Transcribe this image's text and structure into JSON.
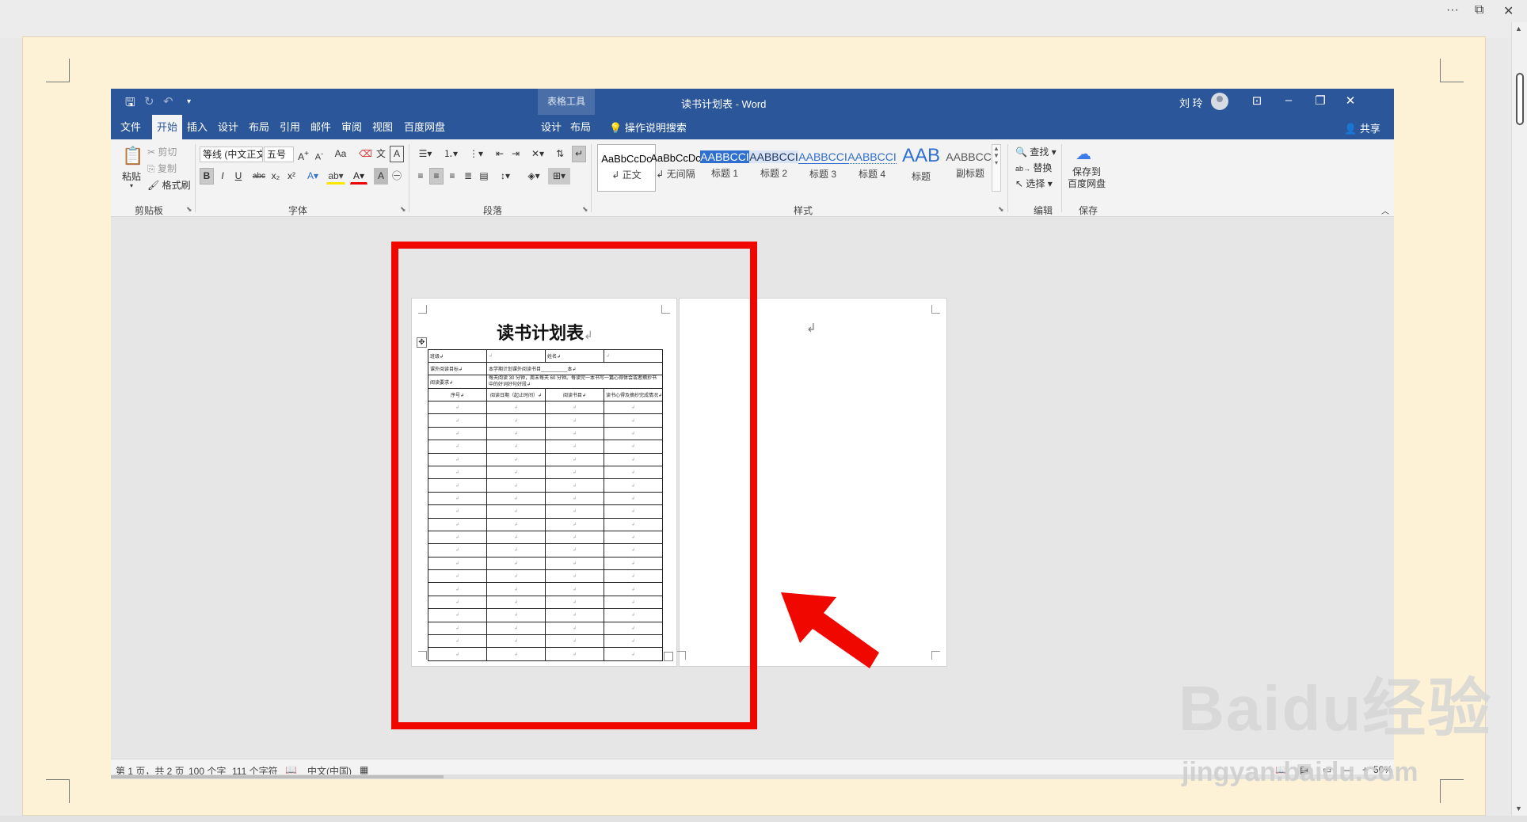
{
  "host": {
    "title_icons": [
      "more-icon",
      "restore-icon",
      "close-icon"
    ]
  },
  "word": {
    "qat": {
      "save_icon": "save-icon",
      "redo_icon": "redo-icon",
      "undo_icon": "undo-icon",
      "customize_icon": "customize-qat-icon"
    },
    "table_tools_label": "表格工具",
    "window_title": "读书计划表 - Word",
    "user_name": "刘 玲",
    "tabs": [
      {
        "label": "文件"
      },
      {
        "label": "开始"
      },
      {
        "label": "插入"
      },
      {
        "label": "设计"
      },
      {
        "label": "布局"
      },
      {
        "label": "引用"
      },
      {
        "label": "邮件"
      },
      {
        "label": "审阅"
      },
      {
        "label": "视图"
      },
      {
        "label": "百度网盘"
      },
      {
        "label": "设计"
      },
      {
        "label": "布局"
      }
    ],
    "tell_me": "操作说明搜索",
    "share": "共享",
    "ribbon": {
      "clipboard": {
        "paste": "粘贴",
        "cut": "剪切",
        "copy": "复制",
        "format_painter": "格式刷",
        "label": "剪贴板"
      },
      "font": {
        "font_name": "等线 (中文正文",
        "font_size": "五号",
        "label": "字体",
        "case": "Aa",
        "bold": "B",
        "italic": "I",
        "underline": "U",
        "strike": "abc",
        "sub": "x₂",
        "sup": "x²"
      },
      "paragraph": {
        "label": "段落"
      },
      "styles": {
        "label": "样式",
        "items": [
          {
            "preview": "AaBbCcDc",
            "name": "↲ 正文"
          },
          {
            "preview": "AaBbCcDc",
            "name": "↲ 无间隔"
          },
          {
            "preview": "AABBCCI",
            "name": "标题 1"
          },
          {
            "preview": "AABBCCI",
            "name": "标题 2"
          },
          {
            "preview": "AABBCCI",
            "name": "标题 3"
          },
          {
            "preview": "AABBCCI",
            "name": "标题 4"
          },
          {
            "preview": "AAB",
            "name": "标题"
          },
          {
            "preview": "AABBCCI",
            "name": "副标题"
          }
        ]
      },
      "editing": {
        "find": "查找",
        "replace": "替换",
        "select": "选择",
        "label": "编辑"
      },
      "save": {
        "line1": "保存到",
        "line2": "百度网盘",
        "label": "保存"
      }
    },
    "document": {
      "title": "读书计划表",
      "row1": {
        "class_label": "班级↲",
        "name_label": "姓名↲"
      },
      "row2": {
        "label": "课外阅读目标↲",
        "value": "本学期计划课外阅读书目__________本↲"
      },
      "row3": {
        "label": "阅读要求↲",
        "value": "每天阅读 30 分钟，周末每天 60 分钟。每读完一本书写一篇心得体会或者摘抄书中的好词好句好段↲"
      },
      "headers": [
        "序号↲",
        "阅读日期（起止时间）↲",
        "阅读书目↲",
        "读书心得及摘抄完成情况↲"
      ],
      "blank_rows": 20,
      "para_mark": "↲"
    },
    "status": {
      "page": "第 1 页，共 2 页",
      "words": "100 个字",
      "chars": "111 个字符",
      "language": "中文(中国)",
      "zoom": "50%"
    }
  },
  "watermark": {
    "brand": "Baidu经验",
    "url": "jingyan.baidu.com"
  }
}
